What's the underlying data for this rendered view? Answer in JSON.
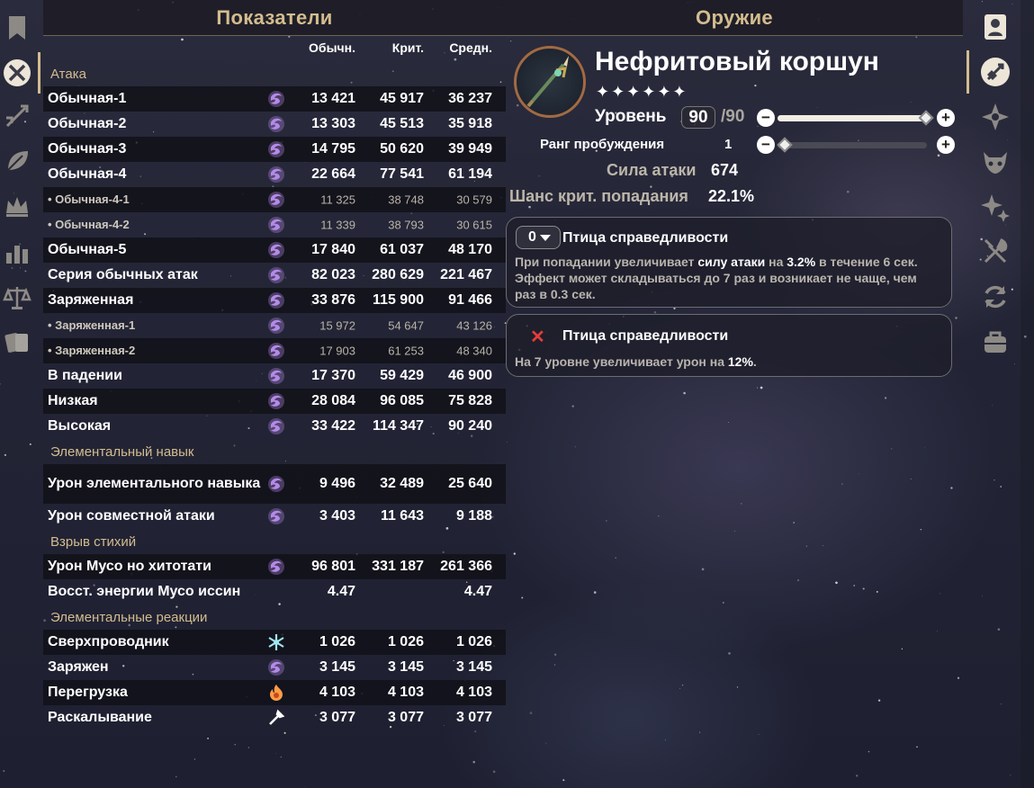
{
  "stats": {
    "title": "Показатели",
    "columns": [
      "Обычн.",
      "Крит.",
      "Средн."
    ],
    "sections": [
      {
        "title": "Атака",
        "rows": [
          {
            "label": "Обычная-1",
            "element": "electro",
            "normal": "13 421",
            "crit": "45 917",
            "avg": "36 237",
            "sub": false
          },
          {
            "label": "Обычная-2",
            "element": "electro",
            "normal": "13 303",
            "crit": "45 513",
            "avg": "35 918",
            "sub": false
          },
          {
            "label": "Обычная-3",
            "element": "electro",
            "normal": "14 795",
            "crit": "50 620",
            "avg": "39 949",
            "sub": false
          },
          {
            "label": "Обычная-4",
            "element": "electro",
            "normal": "22 664",
            "crit": "77 541",
            "avg": "61 194",
            "sub": false
          },
          {
            "label": "• Обычная-4-1",
            "element": "electro",
            "normal": "11 325",
            "crit": "38 748",
            "avg": "30 579",
            "sub": true
          },
          {
            "label": "• Обычная-4-2",
            "element": "electro",
            "normal": "11 339",
            "crit": "38 793",
            "avg": "30 615",
            "sub": true
          },
          {
            "label": "Обычная-5",
            "element": "electro",
            "normal": "17 840",
            "crit": "61 037",
            "avg": "48 170",
            "sub": false
          },
          {
            "label": "Серия обычных атак",
            "element": "electro",
            "normal": "82 023",
            "crit": "280 629",
            "avg": "221 467",
            "sub": false
          },
          {
            "label": "Заряженная",
            "element": "electro",
            "normal": "33 876",
            "crit": "115 900",
            "avg": "91 466",
            "sub": false
          },
          {
            "label": "• Заряженная-1",
            "element": "electro",
            "normal": "15 972",
            "crit": "54 647",
            "avg": "43 126",
            "sub": true
          },
          {
            "label": "• Заряженная-2",
            "element": "electro",
            "normal": "17 903",
            "crit": "61 253",
            "avg": "48 340",
            "sub": true
          },
          {
            "label": "В падении",
            "element": "electro",
            "normal": "17 370",
            "crit": "59 429",
            "avg": "46 900",
            "sub": false
          },
          {
            "label": "Низкая",
            "element": "electro",
            "normal": "28 084",
            "crit": "96 085",
            "avg": "75 828",
            "sub": false
          },
          {
            "label": "Высокая",
            "element": "electro",
            "normal": "33 422",
            "crit": "114 347",
            "avg": "90 240",
            "sub": false
          }
        ]
      },
      {
        "title": "Элементальный навык",
        "rows": [
          {
            "label": "Урон элементального навыка",
            "element": "electro",
            "normal": "9 496",
            "crit": "32 489",
            "avg": "25 640",
            "sub": false,
            "tall": true
          },
          {
            "label": "Урон совместной атаки",
            "element": "electro",
            "normal": "3 403",
            "crit": "11 643",
            "avg": "9 188",
            "sub": false
          }
        ]
      },
      {
        "title": "Взрыв стихий",
        "rows": [
          {
            "label": "Урон Мусо но хитотати",
            "element": "electro",
            "normal": "96 801",
            "crit": "331 187",
            "avg": "261 366",
            "sub": false
          },
          {
            "label": "Восст. энергии Мусо иссин",
            "element": "",
            "normal": "4.47",
            "crit": "",
            "avg": "4.47",
            "sub": false
          }
        ]
      },
      {
        "title": "Элементальные реакции",
        "rows": [
          {
            "label": "Сверхпроводник",
            "element": "cryo",
            "normal": "1 026",
            "crit": "1 026",
            "avg": "1 026",
            "sub": false
          },
          {
            "label": "Заряжен",
            "element": "electro",
            "normal": "3 145",
            "crit": "3 145",
            "avg": "3 145",
            "sub": false
          },
          {
            "label": "Перегрузка",
            "element": "pyro",
            "normal": "4 103",
            "crit": "4 103",
            "avg": "4 103",
            "sub": false
          },
          {
            "label": "Раскалывание",
            "element": "physical",
            "normal": "3 077",
            "crit": "3 077",
            "avg": "3 077",
            "sub": false
          }
        ]
      }
    ]
  },
  "weapon": {
    "title": "Оружие",
    "name": "Нефритовый коршун",
    "stars": "✦✦✦✦✦✦",
    "level_label": "Уровень",
    "level": "90",
    "level_max": "/90",
    "level_fraction": 1.0,
    "refine_label": "Ранг пробуждения",
    "refine": "1",
    "refine_fraction": 0.0,
    "atk_label": "Сила атаки",
    "atk": "674",
    "crit_label": "Шанс крит. попадания",
    "crit": "22.1%",
    "passive1": {
      "stacks": "0",
      "title": "Птица справедливости",
      "desc_parts": [
        {
          "t": "При попадании увеличивает ",
          "hl": false
        },
        {
          "t": "силу атаки",
          "hl": true
        },
        {
          "t": " на ",
          "hl": false
        },
        {
          "t": "3.2%",
          "hl": true
        },
        {
          "t": " в течение 6 сек. Эффект может складываться до 7 раз и возникает не чаще, чем раз в 0.3 сек.",
          "hl": false
        }
      ]
    },
    "passive2": {
      "title": "Птица справедливости",
      "desc_parts": [
        {
          "t": "На 7 уровне увеличивает урон на ",
          "hl": false
        },
        {
          "t": "12%",
          "hl": true
        },
        {
          "t": ".",
          "hl": false
        }
      ]
    }
  },
  "colors": {
    "accent": "#d3bc8e",
    "electro": "#b48ae8",
    "cryo": "#9fe6f0",
    "pyro": "#ff9b47",
    "physical": "#ffffff",
    "close_x": "#e83b3b"
  },
  "left_rail_icons": [
    "bookmark-icon",
    "crossed-swords-icon",
    "spear-icon",
    "leaf-icon",
    "crown-icon",
    "bar-chart-icon",
    "scales-icon",
    "cards-icon"
  ],
  "right_rail_icons": [
    "character-portrait-icon",
    "sword-shield-icon",
    "compass-star-icon",
    "demon-mask-icon",
    "sparkles-icon",
    "utensils-icon",
    "refresh-icon",
    "bag-icon"
  ]
}
